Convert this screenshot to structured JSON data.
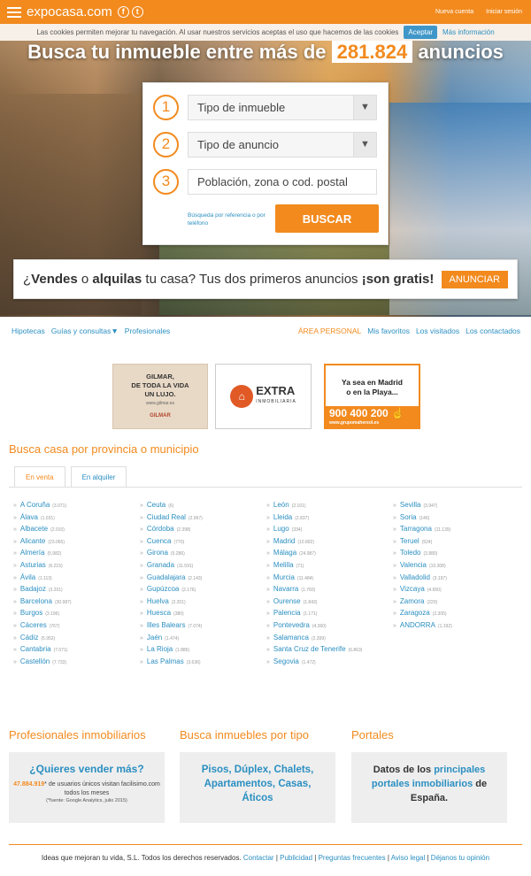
{
  "header": {
    "logo": "expocasa.com",
    "social": [
      "f",
      "t"
    ],
    "links": [
      "Nueva cuenta",
      "Iniciar sesión"
    ]
  },
  "cookie": {
    "text": "Las cookies permiten mejorar tu navegación. Al usar nuestros servicios aceptas el uso que hacemos de las cookies",
    "accept": "Aceptar",
    "more": "Más información"
  },
  "hero": {
    "title_pre": "Busca tu inmueble entre más de",
    "count": "281.824",
    "title_post": "anuncios"
  },
  "search": {
    "steps": [
      "1",
      "2",
      "3"
    ],
    "tipo_inmueble": "Tipo de inmueble",
    "tipo_anuncio": "Tipo de anuncio",
    "poblacion_placeholder": "Población, zona o cod. postal",
    "ref_link": "Búsqueda por referencia o por teléfono",
    "button": "BUSCAR"
  },
  "vende": {
    "q": "¿",
    "vendes": "Vendes",
    "o": " o ",
    "alquilas": "alquilas",
    "rest": " tu casa? Tus dos primeros anuncios ",
    "gratis": "¡son gratis!",
    "button": "ANUNCIAR"
  },
  "nav": {
    "left": [
      "Hipotecas",
      "Guías y consultas▼",
      "Profesionales"
    ],
    "right": [
      "ÁREA PERSONAL",
      "Mis favoritos",
      "Los visitados",
      "Los contactados"
    ]
  },
  "ads": {
    "gilmar_lines": [
      "GILMAR,",
      "DE TODA LA VIDA",
      "UN LUJO."
    ],
    "gilmar_url": "www.gilmar.es",
    "gilmar_brand": "GILMAR",
    "extra_name": "EXTRA",
    "extra_sub": "INMOBILIARIA",
    "madrid_lines": [
      "Ya sea en Madrid",
      "o en la Playa..."
    ],
    "madrid_phone": "900 400 200",
    "madrid_url": "www.grupomahersol.es"
  },
  "provincias": {
    "title": "Busca casa por provincia o municipio",
    "tabs": [
      "En venta",
      "En alquiler"
    ],
    "columns": [
      [
        [
          "A Coruña",
          "(3.071)"
        ],
        [
          "Álava",
          "(1.031)"
        ],
        [
          "Albacete",
          "(2.010)"
        ],
        [
          "Alicante",
          "(23.065)"
        ],
        [
          "Almería",
          "(5.982)"
        ],
        [
          "Asturias",
          "(6.215)"
        ],
        [
          "Ávila",
          "(1.113)"
        ],
        [
          "Badajoz",
          "(3.201)"
        ],
        [
          "Barcelona",
          "(30.987)"
        ],
        [
          "Burgos",
          "(3.196)"
        ],
        [
          "Cáceres",
          "(767)"
        ],
        [
          "Cádiz",
          "(5.952)"
        ],
        [
          "Cantabria",
          "(7.071)"
        ],
        [
          "Castellón",
          "(7.733)"
        ]
      ],
      [
        [
          "Ceuta",
          "(6)"
        ],
        [
          "Ciudad Real",
          "(2.997)"
        ],
        [
          "Córdoba",
          "(2.398)"
        ],
        [
          "Cuenca",
          "(770)"
        ],
        [
          "Girona",
          "(5.286)"
        ],
        [
          "Granada",
          "(11.591)"
        ],
        [
          "Guadalajara",
          "(2.143)"
        ],
        [
          "Gupúzcoa",
          "(2.176)"
        ],
        [
          "Huelva",
          "(2.201)"
        ],
        [
          "Huesca",
          "(380)"
        ],
        [
          "Illes Balears",
          "(7.074)"
        ],
        [
          "Jaén",
          "(1.474)"
        ],
        [
          "La Rioja",
          "(1.886)"
        ],
        [
          "Las Palmas",
          "(3.636)"
        ]
      ],
      [
        [
          "León",
          "(2.101)"
        ],
        [
          "Lleida",
          "(2.837)"
        ],
        [
          "Lugo",
          "(334)"
        ],
        [
          "Madrid",
          "(10.892)"
        ],
        [
          "Málaga",
          "(24.987)"
        ],
        [
          "Melilla",
          "(71)"
        ],
        [
          "Murcia",
          "(11.484)"
        ],
        [
          "Navarra",
          "(1.760)"
        ],
        [
          "Ourense",
          "(1.843)"
        ],
        [
          "Palencia",
          "(1.171)"
        ],
        [
          "Pontevedra",
          "(4.360)"
        ],
        [
          "Salamanca",
          "(2.399)"
        ],
        [
          "Santa Cruz de Tenerife",
          "(6.863)"
        ],
        [
          "Segovia",
          "(1.472)"
        ]
      ],
      [
        [
          "Sevilla",
          "(3.947)"
        ],
        [
          "Soria",
          "(146)"
        ],
        [
          "Tarragona",
          "(11.139)"
        ],
        [
          "Teruel",
          "(524)"
        ],
        [
          "Toledo",
          "(3.880)"
        ],
        [
          "Valencia",
          "(10.308)"
        ],
        [
          "Valladolid",
          "(3.197)"
        ],
        [
          "Vizcaya",
          "(4.650)"
        ],
        [
          "Zamora",
          "(220)"
        ],
        [
          "Zaragoza",
          "(2.305)"
        ],
        [
          "ANDORRA",
          "(1.192)"
        ]
      ]
    ]
  },
  "bottom": {
    "pro_title": "Profesionales inmobiliarios",
    "pro_q": "¿Quieres vender más?",
    "pro_num": "47.884.919",
    "pro_text": "* de usuarios únicos visitan facilisimo.com todos los meses",
    "pro_fuente": "(*fuente: Google Analytics, julio 2015)",
    "tipo_title": "Busca inmuebles por tipo",
    "tipos": [
      "Pisos",
      "Dúplex",
      "Chalets",
      "Apartamentos",
      "Casas",
      "Áticos"
    ],
    "portales_title": "Portales",
    "portales_pre": "Datos de los ",
    "portales_link": "principales portales inmobiliarios",
    "portales_post": " de España."
  },
  "footer": {
    "copy": "Ideas que mejoran tu vida, S.L. Todos los derechos reservados.",
    "links": [
      "Contactar",
      "Publicidad",
      "Preguntas frecuentes",
      "Aviso legal",
      "Déjanos tu opinión"
    ]
  },
  "colors": {
    "brand": "#f28a1e",
    "link": "#2b8fc1"
  }
}
